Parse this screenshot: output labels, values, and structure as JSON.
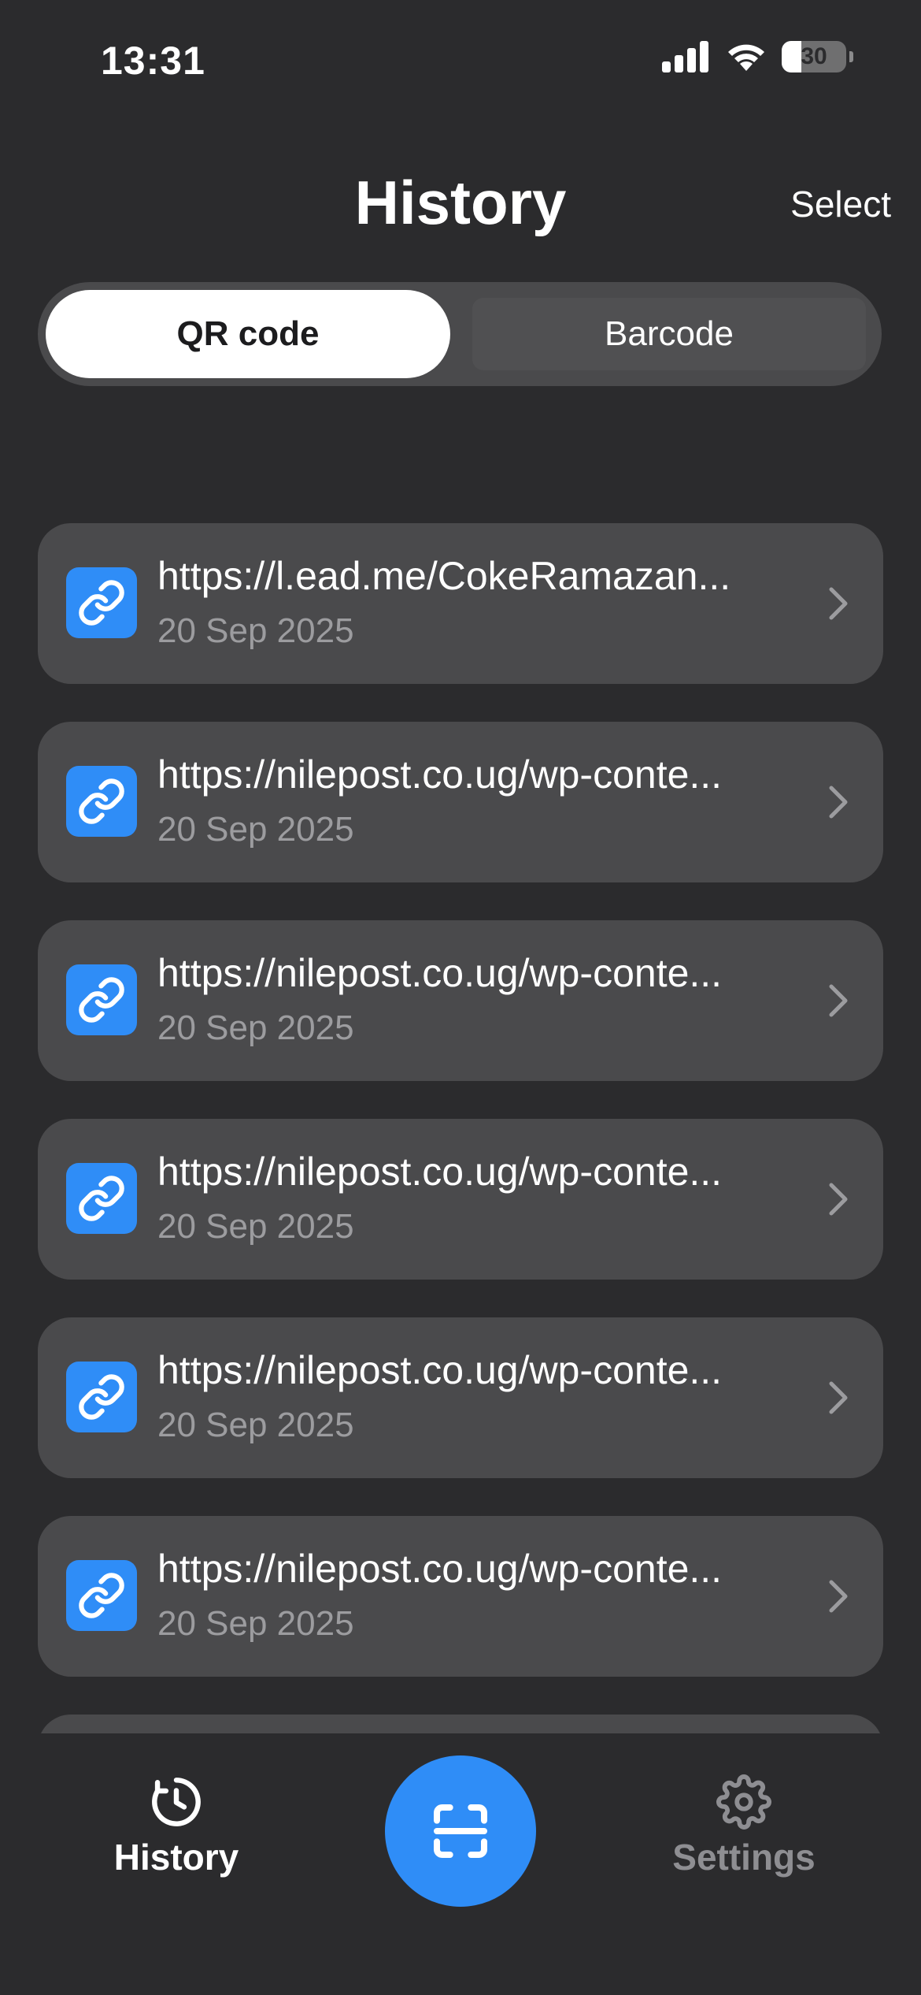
{
  "status_bar": {
    "time": "13:31",
    "battery_level": "30",
    "battery_fraction": 0.3,
    "icons": [
      "signal-icon",
      "wifi-icon",
      "battery-icon"
    ]
  },
  "header": {
    "title": "History",
    "select_label": "Select"
  },
  "segmented_control": {
    "options": [
      "QR code",
      "Barcode"
    ],
    "selected": "QR code"
  },
  "history": {
    "items": [
      {
        "title": "https://l.ead.me/CokeRamazan...",
        "date": "20 Sep 2025",
        "icon": "link-icon"
      },
      {
        "title": "https://nilepost.co.ug/wp-conte...",
        "date": "20 Sep 2025",
        "icon": "link-icon"
      },
      {
        "title": "https://nilepost.co.ug/wp-conte...",
        "date": "20 Sep 2025",
        "icon": "link-icon"
      },
      {
        "title": "https://nilepost.co.ug/wp-conte...",
        "date": "20 Sep 2025",
        "icon": "link-icon"
      },
      {
        "title": "https://nilepost.co.ug/wp-conte...",
        "date": "20 Sep 2025",
        "icon": "link-icon"
      },
      {
        "title": "https://nilepost.co.ug/wp-conte...",
        "date": "20 Sep 2025",
        "icon": "link-icon"
      },
      {
        "title": "",
        "date": "",
        "icon": "link-icon"
      }
    ]
  },
  "tab_bar": {
    "history_label": "History",
    "settings_label": "Settings",
    "active": "History"
  },
  "colors": {
    "background": "#2b2b2d",
    "card": "#4a4a4c",
    "accent": "#2f8df7",
    "secondary_text": "#9c9c9f",
    "inactive_tab": "#8e8e92"
  }
}
